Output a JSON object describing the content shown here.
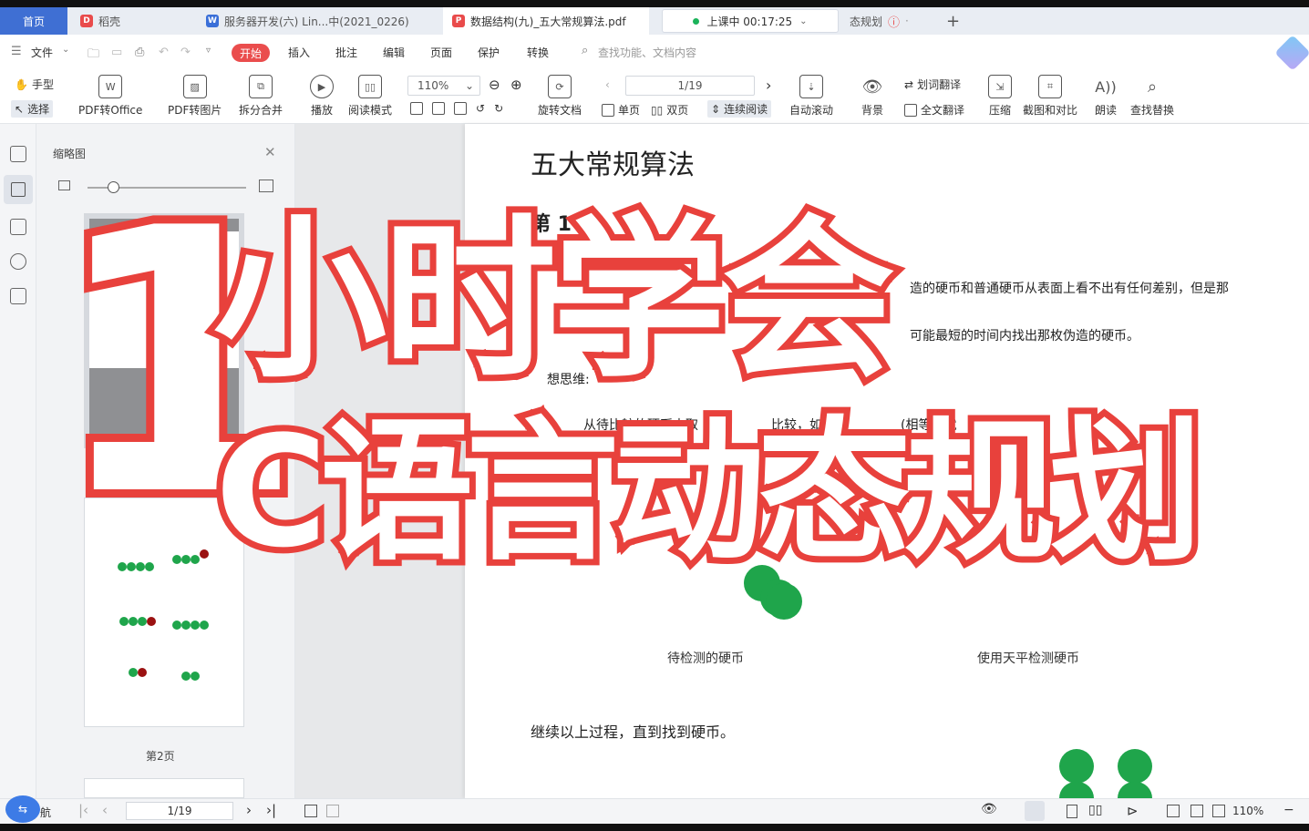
{
  "tabs": [
    {
      "label": "首页"
    },
    {
      "label": "稻壳"
    },
    {
      "label": "服务器开发(六) Lin...中(2021_0226)"
    },
    {
      "label": "数据结构(九)_五大常规算法.pdf"
    },
    {
      "label": "态规划"
    }
  ],
  "recording": {
    "label": "上课中 00:17:25"
  },
  "menu": {
    "file": "文件",
    "start": "开始",
    "items": [
      "插入",
      "批注",
      "编辑",
      "页面",
      "保护",
      "转换"
    ],
    "search_placeholder": "查找功能、文档内容"
  },
  "toolbar": {
    "hand": "手型",
    "select": "选择",
    "pdf_to_office": "PDF转Office",
    "pdf_to_image": "PDF转图片",
    "split_merge": "拆分合并",
    "play": "播放",
    "read_mode": "阅读模式",
    "zoom": "110%",
    "rotate": "旋转文档",
    "page_indicator": "1/19",
    "single_page": "单页",
    "double_page": "双页",
    "continuous": "连续阅读",
    "auto_scroll": "自动滚动",
    "background": "背景",
    "word_translate": "划词翻译",
    "full_translate": "全文翻译",
    "compress": "压缩",
    "screenshot_compare": "截图和对比",
    "read_aloud": "朗读",
    "find_replace": "查找替换"
  },
  "thumbnail_panel": {
    "title": "缩略图",
    "page2_label": "第2页"
  },
  "document": {
    "title": "五大常规算法",
    "heading": "第 1 章",
    "line1": "造的硬币和普通硬币从表面上看不出有任何差别，但是那",
    "line2": "可能最短的时间内找出那枚伪造的硬币。",
    "line3": "想思维:",
    "line4": "从待比较的硬币中取",
    "line5": "比较，如果天",
    "line6": "(相等）就",
    "caption_left": "待检测的硬币",
    "caption_right": "使用天平检测硬币",
    "continue_text": "继续以上过程，直到找到硬币。"
  },
  "statusbar": {
    "nav": "航",
    "page_indicator": "1/19",
    "zoom": "110%"
  },
  "overlay": {
    "line1_number": "1",
    "line1_text": "小时学会",
    "line2_text": "C语言动态规划"
  },
  "colors": {
    "accent": "#ea4d4d",
    "overlay_stroke": "#e8413c",
    "home_tab": "#3f6fd3",
    "coin_green": "#1fa54b"
  }
}
